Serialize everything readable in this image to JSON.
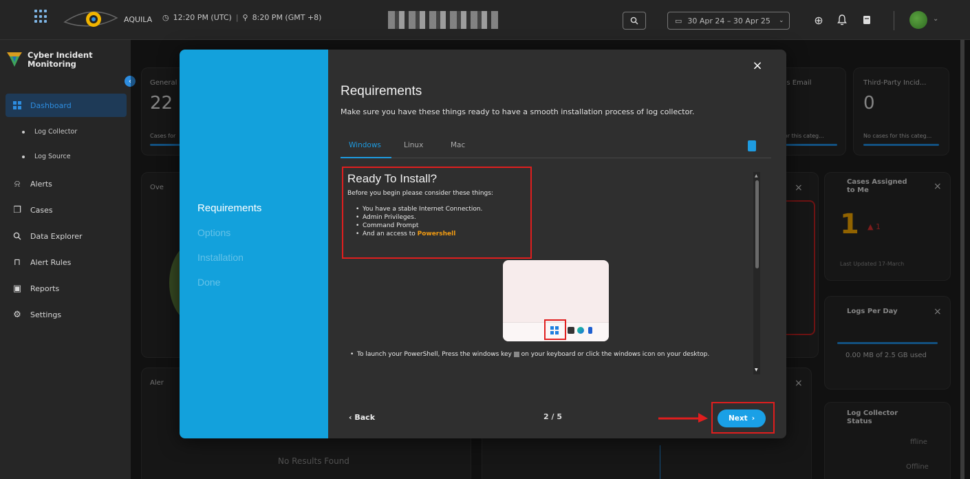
{
  "topbar": {
    "brand": "AQUILA",
    "utc_time": "12:20 PM (UTC)",
    "local_time": "8:20 PM (GMT +8)",
    "date_range": "30 Apr 24 – 30 Apr 25"
  },
  "sidebar": {
    "title_line1": "Cyber Incident",
    "title_line2": "Monitoring",
    "items": [
      {
        "label": "Dashboard",
        "icon": "dashboard-icon"
      },
      {
        "label": "Log Collector"
      },
      {
        "label": "Log Source"
      },
      {
        "label": "Alerts",
        "icon": "bell-icon"
      },
      {
        "label": "Cases",
        "icon": "cases-icon"
      },
      {
        "label": "Data Explorer",
        "icon": "search-icon"
      },
      {
        "label": "Alert Rules",
        "icon": "rules-icon"
      },
      {
        "label": "Reports",
        "icon": "report-icon"
      },
      {
        "label": "Settings",
        "icon": "settings-icon"
      }
    ]
  },
  "dashboard": {
    "general_label": "General",
    "general_value": "22",
    "cases_for": "Cases for",
    "us_email": "us Email",
    "third_party": "Third-Party Incid...",
    "third_party_value": "0",
    "no_cases_categ": "No cases for this categ...",
    "for_this_categ": "for this categ...",
    "overview_label": "Ove",
    "alerts_label": "Aler",
    "cases_assigned_1": "Cases Assigned",
    "cases_assigned_2": "to Me",
    "cases_assigned_value": "1",
    "cases_assigned_delta": "1",
    "last_updated": "Last Updated 17-March",
    "logs_per_day": "Logs Per Day",
    "logs_used": "0.00 MB of 2.5 GB used",
    "log_collector_1": "Log Collector",
    "log_collector_2": "Status",
    "offline_1": "ffline",
    "offline_2": "Offline",
    "no_results": "No Results Found"
  },
  "modal": {
    "steps": [
      "Requirements",
      "Options",
      "Installation",
      "Done"
    ],
    "title": "Requirements",
    "subtitle": "Make sure you have these things ready to have a smooth installation process of log collector.",
    "tabs": [
      "Windows",
      "Linux",
      "Mac"
    ],
    "ready_title": "Ready To Install?",
    "ready_lead": "Before you begin please consider these things:",
    "requirements": [
      "You have a stable Internet Connection.",
      "Admin Privileges.",
      "Command Prompt"
    ],
    "access_prefix": "And an access to ",
    "access_link": "Powershell",
    "launch_text_1": "To launch your PowerShell, Press the windows key",
    "launch_text_2": "on your keyboard or click the windows icon on your desktop.",
    "back_label": "Back",
    "pager": "2 / 5",
    "next_label": "Next",
    "close": "×"
  }
}
